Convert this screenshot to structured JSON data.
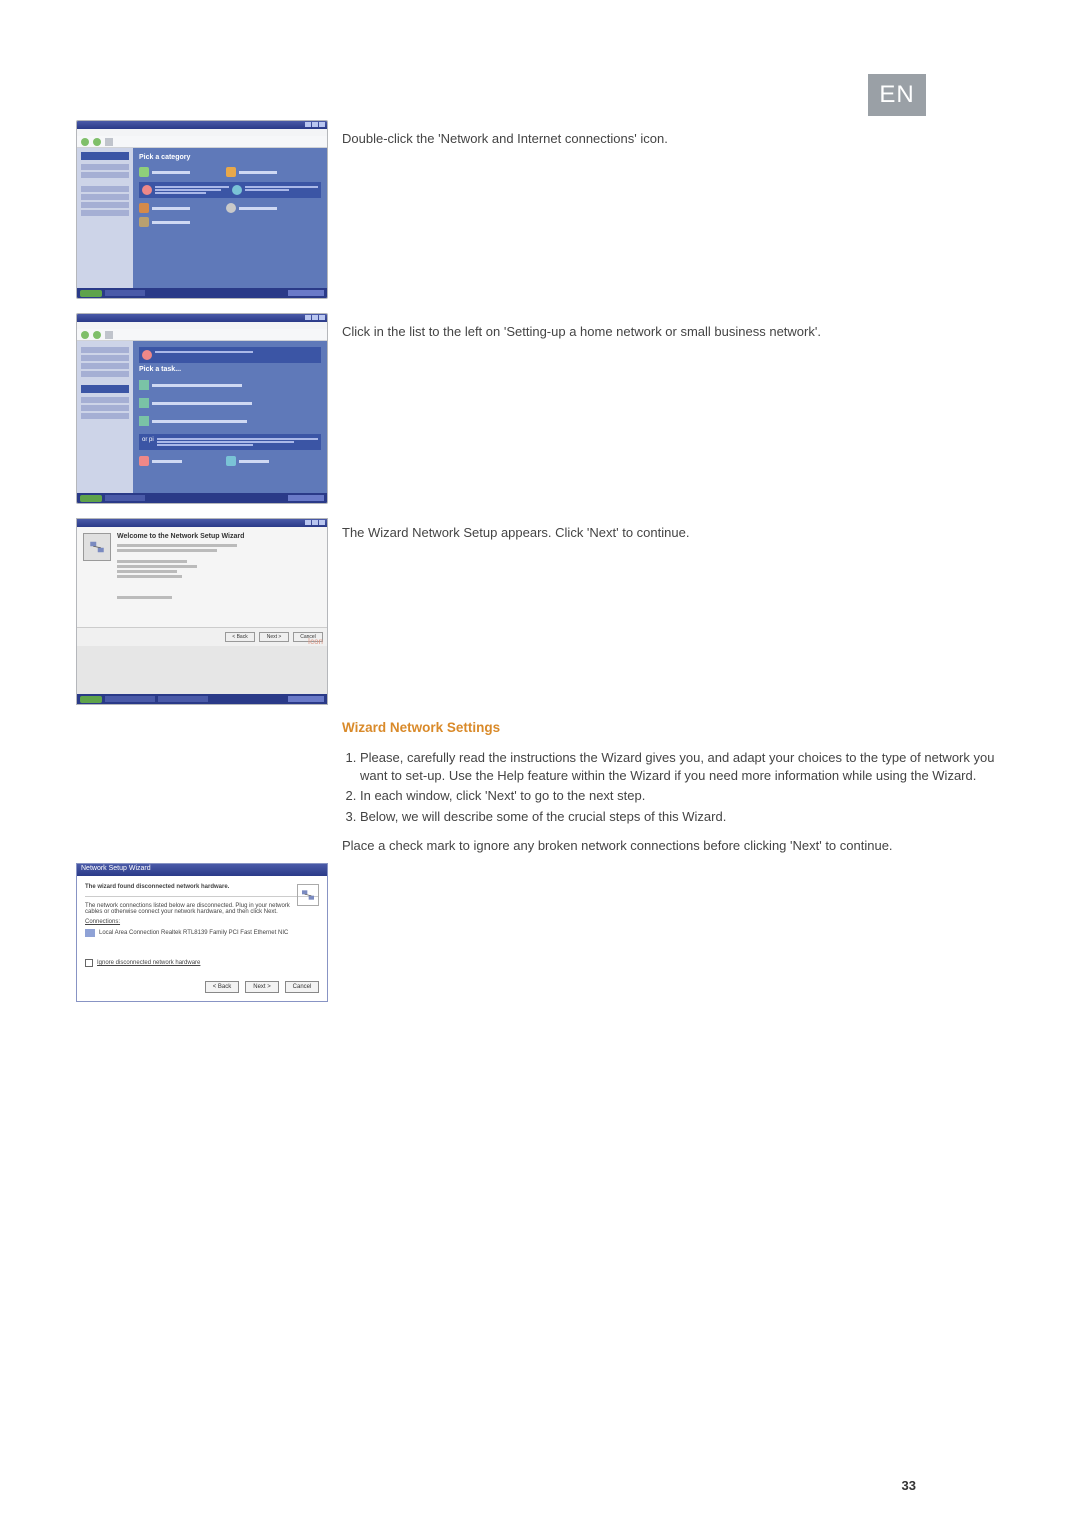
{
  "language_badge": "EN",
  "page_number": "33",
  "step1": {
    "caption": "Double-click the 'Network and Internet connections' icon.",
    "screenshot_heading": "Pick a category"
  },
  "step2": {
    "caption": "Click in the list to the left on 'Setting-up a home network or small business network'.",
    "screenshot_heading": "Pick a task...",
    "screenshot_orpick": "or pi"
  },
  "step3": {
    "caption": "The Wizard Network Setup appears. Click 'Next' to continue.",
    "wizard_title": "Welcome to the Network Setup Wizard",
    "btn_back": "< Back",
    "btn_next": "Next >",
    "btn_cancel": "Cancel",
    "icon_label": "Icon"
  },
  "settings": {
    "heading": "Wizard Network Settings",
    "items": [
      "Please, carefully read the instructions the Wizard gives you, and adapt your choices to the type of network you want to set-up. Use the Help feature within the Wizard if you need more information while using the Wizard.",
      "In each window, click 'Next' to go to the next step.",
      "Below, we will describe some of the crucial steps of this Wizard."
    ],
    "check_para": "Place a check mark to ignore any broken network connections before clicking 'Next' to continue."
  },
  "dialog": {
    "title": "Network Setup Wizard",
    "bold_line": "The wizard found disconnected network hardware.",
    "desc": "The network connections listed below are disconnected. Plug in your network cables or otherwise connect your network hardware, and then click Next.",
    "connections_label": "Connections:",
    "conn_item": "Local Area Connection   Realtek RTL8139 Family PCI Fast Ethernet NIC",
    "checkbox_label": "Ignore disconnected network hardware",
    "btn_back": "< Back",
    "btn_next": "Next >",
    "btn_cancel": "Cancel"
  }
}
